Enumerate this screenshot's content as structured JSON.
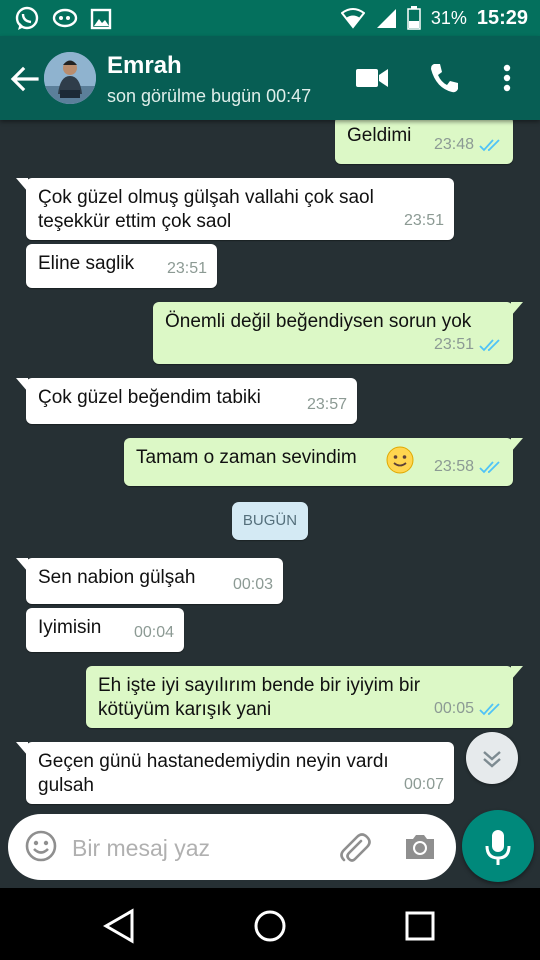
{
  "status_bar": {
    "battery": "31%",
    "time": "15:29"
  },
  "header": {
    "contact_name": "Emrah",
    "last_seen": "son görülme bugün 00:47"
  },
  "messages": [
    {
      "dir": "out",
      "text": "Geldimi",
      "time": "23:48"
    },
    {
      "dir": "in",
      "text": "Çok güzel olmuş gülşah vallahi çok saol teşekkür ettim çok saol",
      "time": "23:51"
    },
    {
      "dir": "in",
      "text": "Eline saglik",
      "time": "23:51"
    },
    {
      "dir": "out",
      "text": "Önemli değil beğendiysen sorun yok",
      "time": "23:51"
    },
    {
      "dir": "in",
      "text": "Çok güzel beğendim tabiki",
      "time": "23:57"
    },
    {
      "dir": "out",
      "text": "Tamam o zaman sevindim",
      "time": "23:58"
    },
    {
      "dir": "in",
      "text": "Sen nabion gülşah",
      "time": "00:03"
    },
    {
      "dir": "in",
      "text": "Iyimisin",
      "time": "00:04"
    },
    {
      "dir": "out",
      "text": "Eh işte iyi sayılırım bende bir iyiyim bir kötüyüm karışık yani",
      "time": "00:05"
    },
    {
      "dir": "in",
      "text": "Geçen günü hastanedemiydin neyin vardı gulsah",
      "time": "00:07"
    }
  ],
  "date_divider": "BUGÜN",
  "input": {
    "placeholder": "Bir mesaj yaz",
    "value": ""
  },
  "icons": {
    "status": [
      "whatsapp-icon",
      "message-icon",
      "image-icon",
      "wifi-icon",
      "signal-icon",
      "battery-icon"
    ],
    "header": [
      "back-arrow-icon",
      "video-call-icon",
      "phone-call-icon",
      "more-options-icon"
    ],
    "input": [
      "emoji-icon",
      "attach-icon",
      "camera-icon",
      "mic-icon"
    ],
    "nav": [
      "back-nav-icon",
      "home-nav-icon",
      "recents-nav-icon"
    ]
  },
  "colors": {
    "header": "#075e54",
    "status_bar": "#04705d",
    "outgoing_bubble": "#dcf8c6",
    "incoming_bubble": "#ffffff",
    "read_ticks": "#4fc3f7",
    "mic_button": "#00897b"
  }
}
